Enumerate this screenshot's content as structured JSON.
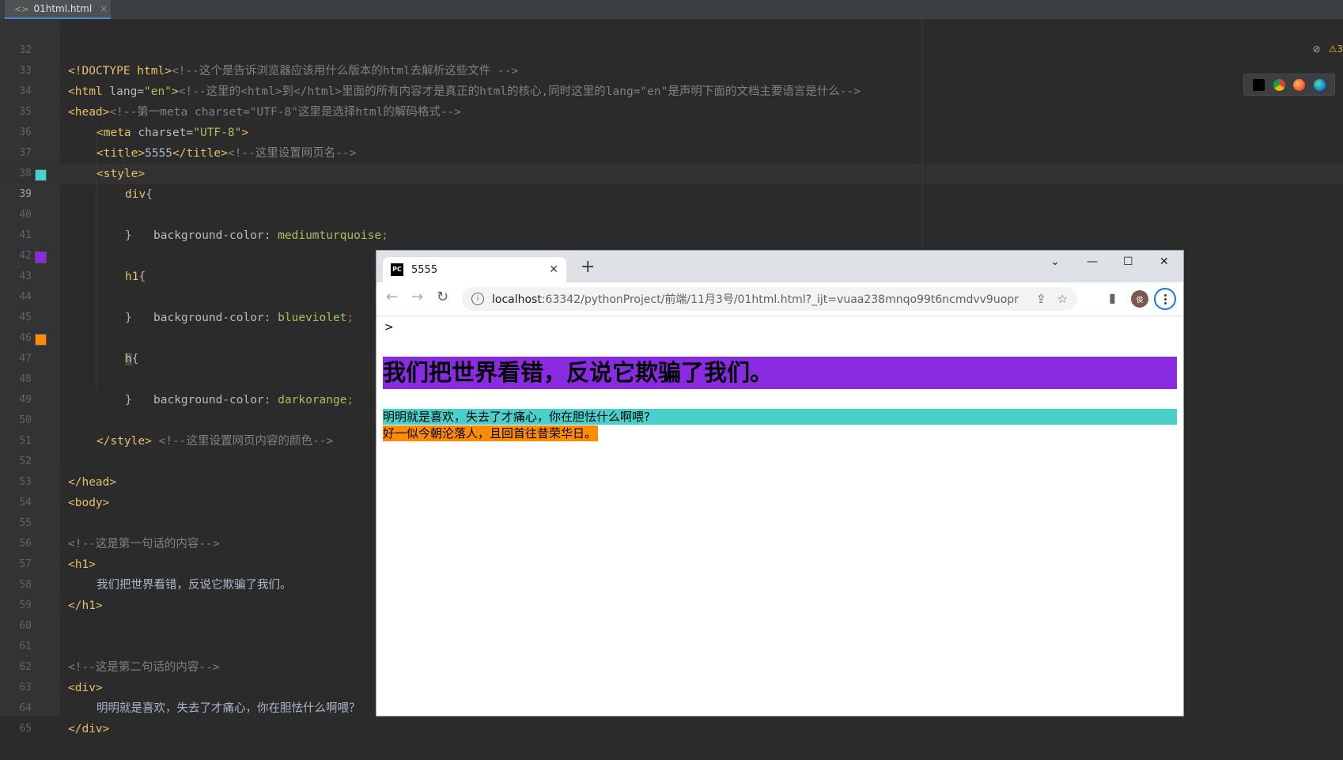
{
  "ide": {
    "file_tab": "01html.html",
    "file_tab_close": "×",
    "inspection_count": "3",
    "lines": [
      {
        "n": "32"
      },
      {
        "n": "33"
      },
      {
        "n": "34"
      },
      {
        "n": "35"
      },
      {
        "n": "36"
      },
      {
        "n": "37"
      },
      {
        "n": "38"
      },
      {
        "n": "39"
      },
      {
        "n": "40"
      },
      {
        "n": "41"
      },
      {
        "n": "42"
      },
      {
        "n": "43"
      },
      {
        "n": "44"
      },
      {
        "n": "45"
      },
      {
        "n": "46"
      },
      {
        "n": "47"
      },
      {
        "n": "48"
      },
      {
        "n": "49"
      },
      {
        "n": "50"
      },
      {
        "n": "51"
      },
      {
        "n": "52"
      },
      {
        "n": "53"
      },
      {
        "n": "54"
      },
      {
        "n": "55"
      },
      {
        "n": "56"
      },
      {
        "n": "57"
      },
      {
        "n": "58"
      },
      {
        "n": "59"
      },
      {
        "n": "60"
      },
      {
        "n": "61"
      },
      {
        "n": "62"
      },
      {
        "n": "63"
      },
      {
        "n": "64"
      },
      {
        "n": "65"
      }
    ],
    "code": {
      "l32_a": "<!DOCTYPE html>",
      "l32_c": "<!--这个是告诉浏览器应该用什么版本的html去解析这些文件 -->",
      "l33_a": "<html ",
      "l33_attr": "lang=",
      "l33_str": "\"en\"",
      "l33_b": ">",
      "l33_c": "<!--这里的<html>到</html>里面的所有内容才是真正的html的核心,同时这里的lang=\"en\"是声明下面的文档主要语言是什么-->",
      "l34_a": "<head>",
      "l34_c": "<!--第一meta charset=\"UTF-8\"这里是选择html的解码格式-->",
      "l35_a": "<meta ",
      "l35_attr": "charset=",
      "l35_str": "\"UTF-8\"",
      "l35_b": ">",
      "l36_a": "<title>",
      "l36_t": "5555",
      "l36_b": "</title>",
      "l36_c": "<!--这里设置网页名-->",
      "l37_a": "<style>",
      "l38_sel": "div",
      "l38_b": "{",
      "l39_prop": "background-color",
      "l39_colon": ": ",
      "l39_val": "mediumturquoise",
      "l39_semi": ";",
      "l40_b": "}",
      "l42_sel": "h1",
      "l42_b": "{",
      "l43_prop": "background-color",
      "l43_colon": ": ",
      "l43_val": "blueviolet",
      "l43_semi": ";",
      "l44_b": "}",
      "l46_sel": "h",
      "l46_b": "{",
      "l47_prop": "background-color",
      "l47_colon": ": ",
      "l47_val": "darkorange",
      "l47_semi": ";",
      "l48_b": "}",
      "l50_a": "</style>",
      "l50_c": " <!--这里设置网页内容的颜色-->",
      "l52_a": "</head>",
      "l53_a": "<body>",
      "l55_c": "<!--这是第一句话的内容-->",
      "l56_a": "<h1>",
      "l57_t": "我们把世界看错，反说它欺骗了我们。",
      "l58_a": "</h1>",
      "l61_c": "<!--这是第二句话的内容-->",
      "l62_a": "<div>",
      "l63_t": "明明就是喜欢，失去了才痛心，你在胆怯什么啊喂？",
      "l64_a": "</div>"
    },
    "swatches": {
      "mediumturquoise": "#48d1cc",
      "blueviolet": "#8a2be2",
      "darkorange": "#ff8c00"
    }
  },
  "browser": {
    "tab_title": "5555",
    "tab_favicon": "PC",
    "tab_close": "✕",
    "new_tab": "+",
    "url_host": "localhost",
    "url_rest": ":63342/pythonProject/前端/11月3号/01html.html?_ijt=vuaa238mnqo99t6ncmdvv9uopr",
    "avatar_text": "俊",
    "page": {
      "stray_text": ">",
      "h1": "我们把世界看错，反说它欺骗了我们。",
      "div": "明明就是喜欢，失去了才痛心，你在胆怯什么啊喂?",
      "h": "好一似今朝沦落人，且回首往昔荣华日。"
    }
  }
}
